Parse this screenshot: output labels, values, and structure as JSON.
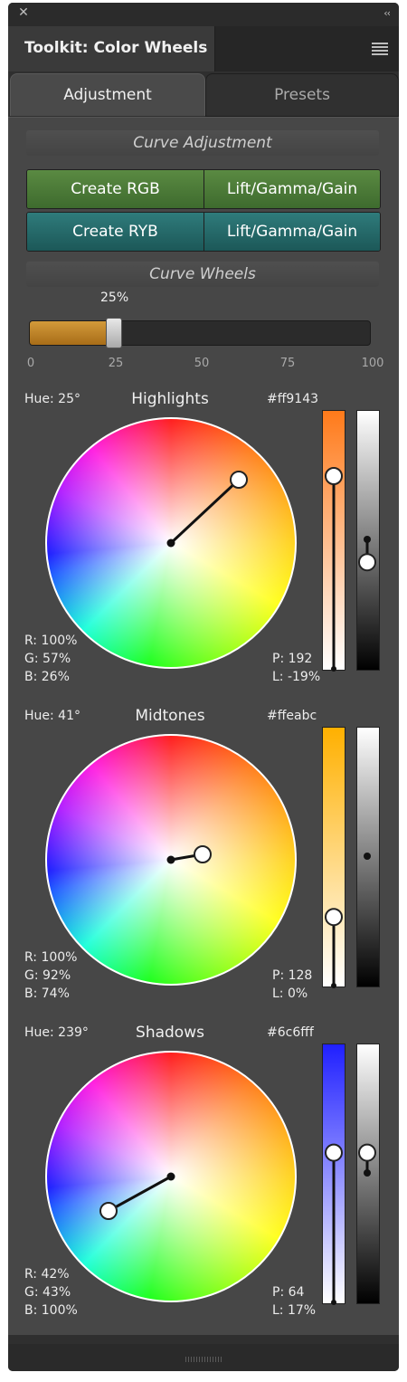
{
  "window": {
    "close_glyph": "✕",
    "collapse_glyph": "‹‹"
  },
  "header": {
    "title": "Toolkit: Color Wheels"
  },
  "tabs": [
    {
      "label": "Adjustment"
    },
    {
      "label": "Presets"
    }
  ],
  "curve_adjustment": {
    "label": "Curve Adjustment",
    "rgb_row": {
      "create": "Create RGB",
      "lgg": "Lift/Gamma/Gain"
    },
    "ryb_row": {
      "create": "Create RYB",
      "lgg": "Lift/Gamma/Gain"
    }
  },
  "curve_wheels": {
    "label": "Curve Wheels",
    "slider": {
      "value_label": "25%",
      "value": 25,
      "ticks": [
        "0",
        "25",
        "50",
        "75",
        "100"
      ]
    }
  },
  "wheels": [
    {
      "title": "Highlights",
      "hue": "Hue: 25°",
      "hex": "#ff9143",
      "r": "R: 100%",
      "g": "G: 57%",
      "b": "B: 26%",
      "p": "P: 192",
      "l": "L: -19%",
      "color_bar_top": "#ff7a1a",
      "color_bar_position": 0.25,
      "luma_bar_position": 0.59,
      "luma_value": -0.19
    },
    {
      "title": "Midtones",
      "hue": "Hue: 41°",
      "hex": "#ffeabc",
      "r": "R: 100%",
      "g": "G: 92%",
      "b": "B: 74%",
      "p": "P: 128",
      "l": "L: 0%",
      "color_bar_top": "#ffb000",
      "color_bar_position": 0.74,
      "luma_bar_position": 0.5,
      "luma_value": 0
    },
    {
      "title": "Shadows",
      "hue": "Hue: 239°",
      "hex": "#6c6fff",
      "r": "R: 42%",
      "g": "G: 43%",
      "b": "B: 100%",
      "p": "P: 64",
      "l": "L: 17%",
      "color_bar_top": "#2020ff",
      "color_bar_position": 0.42,
      "luma_bar_position": 0.42,
      "luma_value": 0.17
    }
  ]
}
